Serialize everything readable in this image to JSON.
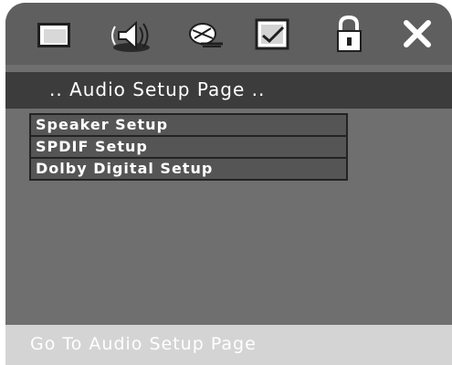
{
  "toolbar": {
    "icons": [
      {
        "name": "general-setup-icon"
      },
      {
        "name": "audio-setup-icon"
      },
      {
        "name": "video-setup-icon"
      },
      {
        "name": "preference-icon"
      },
      {
        "name": "password-lock-icon"
      },
      {
        "name": "exit-icon"
      }
    ],
    "selected": "audio-setup-icon"
  },
  "page": {
    "title": ".. Audio Setup Page .."
  },
  "menu": {
    "items": [
      {
        "label": "Speaker Setup"
      },
      {
        "label": "SPDIF Setup"
      },
      {
        "label": "Dolby Digital Setup"
      }
    ]
  },
  "status": {
    "text": "Go To Audio Setup Page"
  },
  "colors": {
    "panel": "#6f6f6f",
    "toolbar": "#5f5f5f",
    "title_bar": "#3c3c3c",
    "menu_item": "#555555",
    "status_bar": "#d4d4d4",
    "text": "#ffffff"
  }
}
